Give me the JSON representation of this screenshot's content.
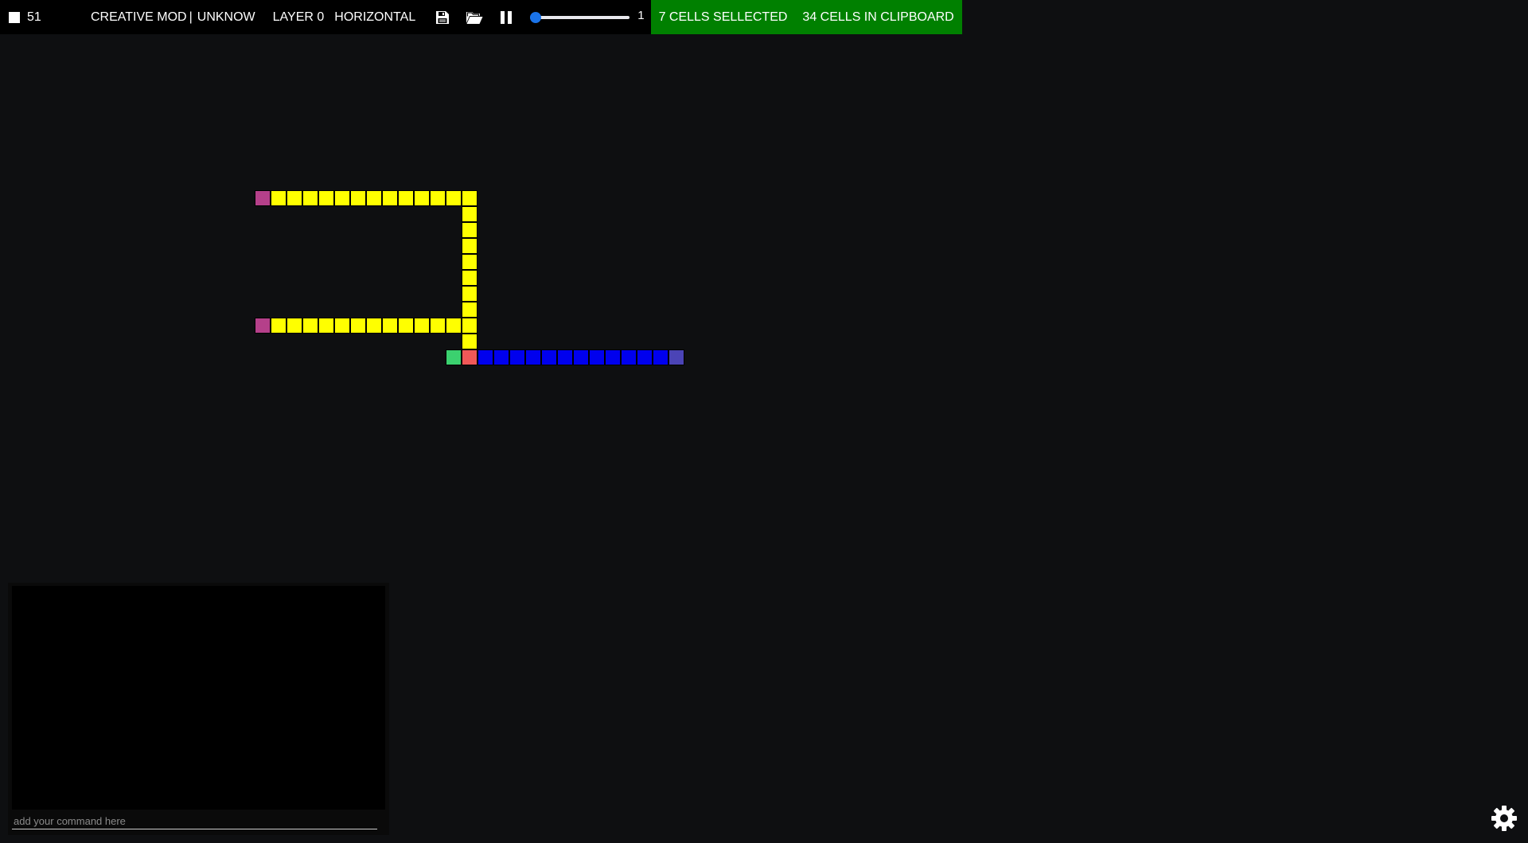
{
  "topbar": {
    "cell_count": "51",
    "mode_label": "CREATIVE MOD",
    "mode_separator": "|",
    "mode_value": "UNKNOW",
    "layer_label": "LAYER 0",
    "orientation_label": "HORIZONTAL",
    "icons": [
      "save-icon",
      "folder-open-icon",
      "pause-icon"
    ],
    "speed_value": "1",
    "speed_fraction": 0,
    "selected_label": "7 CELLS SELLECTED",
    "clipboard_label": "34 CELLS IN CLIPBOARD"
  },
  "colors": {
    "background": "#0e0f11",
    "status_green": "#008000",
    "slider_blue": "#1a73e8",
    "yellow": "#ffff00",
    "magenta": "#b5408a",
    "blue": "#0000ee",
    "slate_blue": "#4b44b6",
    "green": "#3bd16f",
    "red": "#f05858"
  },
  "console": {
    "placeholder": "add your command here"
  },
  "settings": {
    "icon": "gear-icon"
  }
}
